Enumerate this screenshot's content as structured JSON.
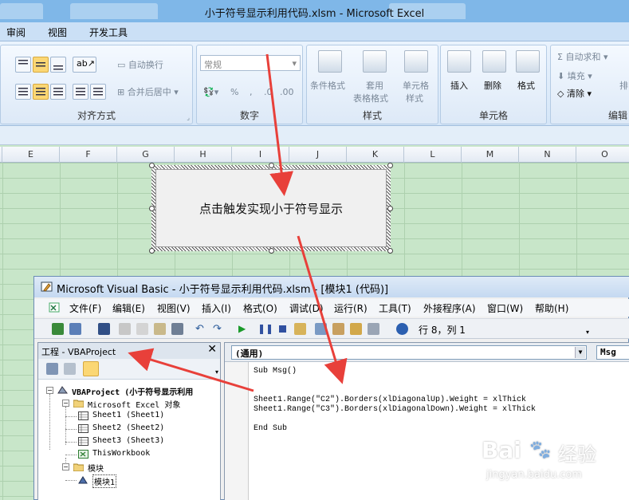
{
  "excel": {
    "title": "小于符号显示利用代码.xlsm - Microsoft Excel",
    "ribbon_tabs": [
      "审阅",
      "视图",
      "开发工具"
    ],
    "groups": {
      "alignment": {
        "label": "对齐方式",
        "wrap_text": "自动换行",
        "merge_center": "合并后居中"
      },
      "number": {
        "label": "数字",
        "format": "常规"
      },
      "styles": {
        "label": "样式",
        "conditional": "条件格式",
        "table_line1": "套用",
        "table_line2": "表格格式",
        "cell_styles_line1": "单元格",
        "cell_styles_line2": "样式"
      },
      "cells": {
        "label": "单元格",
        "insert": "插入",
        "delete": "删除",
        "format": "格式"
      },
      "editing": {
        "label": "编辑",
        "autosum": "自动求和",
        "fill": "填充",
        "clear": "清除",
        "sort": "排"
      }
    },
    "columns": [
      "E",
      "F",
      "G",
      "H",
      "I",
      "J",
      "K",
      "L",
      "M",
      "N",
      "O"
    ],
    "sheet_button_label": "点击触发实现小于符号显示"
  },
  "vbe": {
    "title": "Microsoft Visual Basic - 小于符号显示利用代码.xlsm - [模块1 (代码)]",
    "menu": [
      "文件(F)",
      "编辑(E)",
      "视图(V)",
      "插入(I)",
      "格式(O)",
      "调试(D)",
      "运行(R)",
      "工具(T)",
      "外接程序(A)",
      "窗口(W)",
      "帮助(H)"
    ],
    "cursor_position": "行 8，列 1",
    "project_pane": {
      "title": "工程 - VBAProject",
      "tree": {
        "root": "VBAProject (小于符号显示利用",
        "excel_objects": "Microsoft Excel 对象",
        "sheets": [
          "Sheet1 (Sheet1)",
          "Sheet2 (Sheet2)",
          "Sheet3 (Sheet3)"
        ],
        "workbook": "ThisWorkbook",
        "modules_folder": "模块",
        "module": "模块1"
      }
    },
    "code_pane": {
      "object_select": "(通用)",
      "proc_select": "Msg",
      "lines": [
        "Sub Msg()",
        "",
        "Sheet1.Range(\"C2\").Borders(xlDiagonalUp).Weight = xlThick",
        "Sheet1.Range(\"C3\").Borders(xlDiagonalDown).Weight = xlThick",
        "",
        "End Sub"
      ]
    }
  },
  "watermark": {
    "brand": "Bai",
    "brand2": "经验",
    "url": "jingyan.baidu.com"
  },
  "colors": {
    "arrow": "#e8403a",
    "sheet_bg": "#c8e6c9",
    "title_bar": "#7fb7e8"
  }
}
